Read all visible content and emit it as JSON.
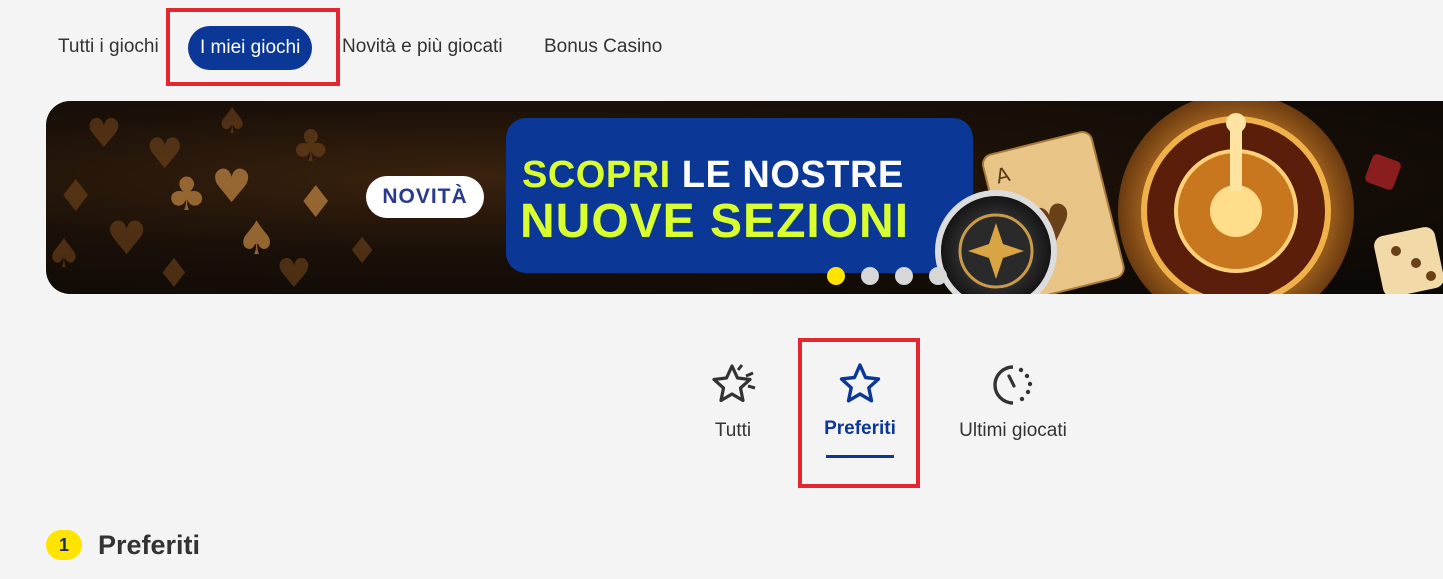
{
  "nav": {
    "tabs": [
      {
        "label": "Tutti i giochi",
        "active": false
      },
      {
        "label": "I miei giochi",
        "active": true
      },
      {
        "label": "Novità e più giocati",
        "active": false
      },
      {
        "label": "Bonus Casino",
        "active": false
      }
    ]
  },
  "banner": {
    "badge": "NOVITÀ",
    "headline_highlight": "SCOPRI",
    "headline_rest": "LE NOSTRE",
    "headline_line2": "NUOVE SEZIONI",
    "slides_total": 4,
    "slide_active": 1
  },
  "subtabs": [
    {
      "label": "Tutti",
      "icon": "stars-icon",
      "active": false
    },
    {
      "label": "Preferiti",
      "icon": "star-outline-icon",
      "active": true
    },
    {
      "label": "Ultimi giocati",
      "icon": "clock-history-icon",
      "active": false
    }
  ],
  "section": {
    "count": "1",
    "title": "Preferiti"
  },
  "colors": {
    "brand_blue": "#0b3796",
    "accent_yellow": "#ffe400",
    "banner_green": "#d9ff2e",
    "highlight_red": "#e3262f",
    "background": "#f4f4f4"
  }
}
